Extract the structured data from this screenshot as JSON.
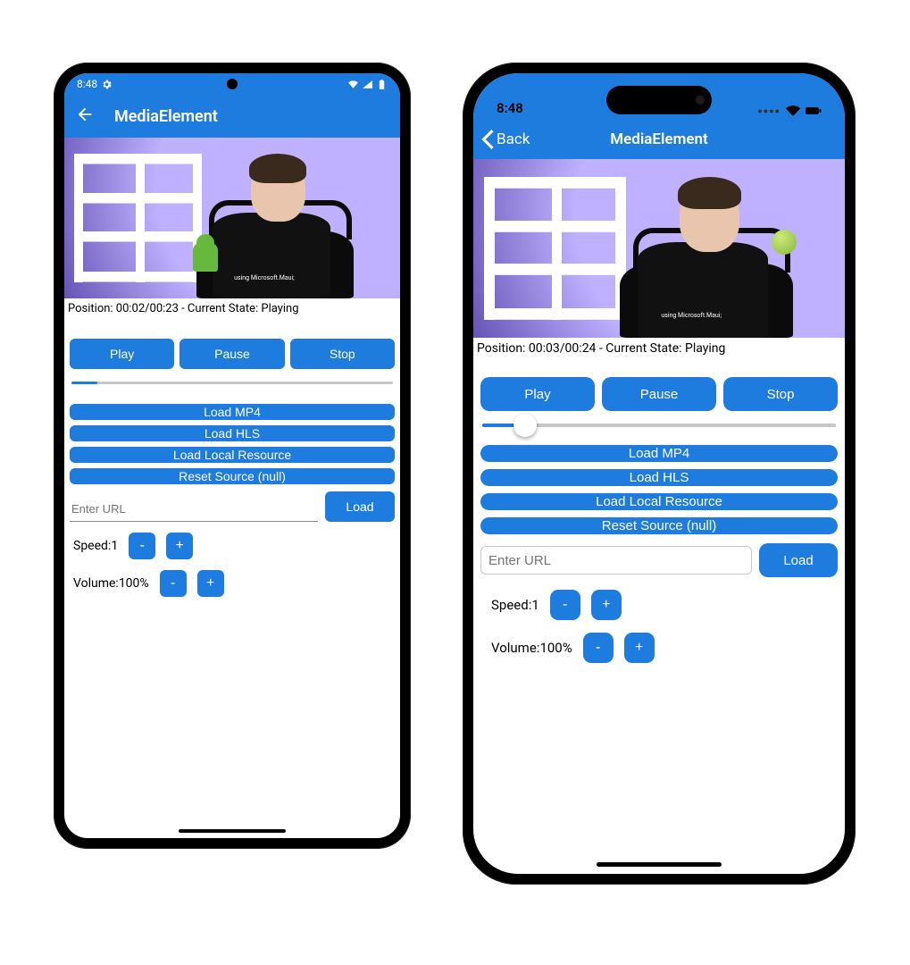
{
  "colors": {
    "accent": "#1e7cdf"
  },
  "android": {
    "status": {
      "time": "8:48"
    },
    "header": {
      "title": "MediaElement"
    },
    "shirt": "using Microsoft.Maui;",
    "position": "Position: 00:02/00:23 - Current State: Playing",
    "buttons": {
      "play": "Play",
      "pause": "Pause",
      "stop": "Stop"
    },
    "loaders": {
      "mp4": "Load MP4",
      "hls": "Load HLS",
      "local": "Load Local Resource",
      "reset": "Reset Source (null)"
    },
    "url": {
      "placeholder": "Enter URL",
      "load": "Load"
    },
    "speed": {
      "label": "Speed:",
      "value": "1",
      "minus": "-",
      "plus": "+"
    },
    "volume": {
      "label": "Volume:",
      "value": "100%",
      "minus": "-",
      "plus": "+"
    }
  },
  "ios": {
    "status": {
      "time": "8:48"
    },
    "header": {
      "back": "Back",
      "title": "MediaElement"
    },
    "shirt": "using Microsoft.Maui;",
    "position": "Position: 00:03/00:24 - Current State: Playing",
    "buttons": {
      "play": "Play",
      "pause": "Pause",
      "stop": "Stop"
    },
    "loaders": {
      "mp4": "Load MP4",
      "hls": "Load HLS",
      "local": "Load Local Resource",
      "reset": "Reset Source (null)"
    },
    "url": {
      "placeholder": "Enter URL",
      "load": "Load"
    },
    "speed": {
      "label": "Speed:",
      "value": "1",
      "minus": "-",
      "plus": "+"
    },
    "volume": {
      "label": "Volume:",
      "value": "100%",
      "minus": "-",
      "plus": "+"
    }
  }
}
